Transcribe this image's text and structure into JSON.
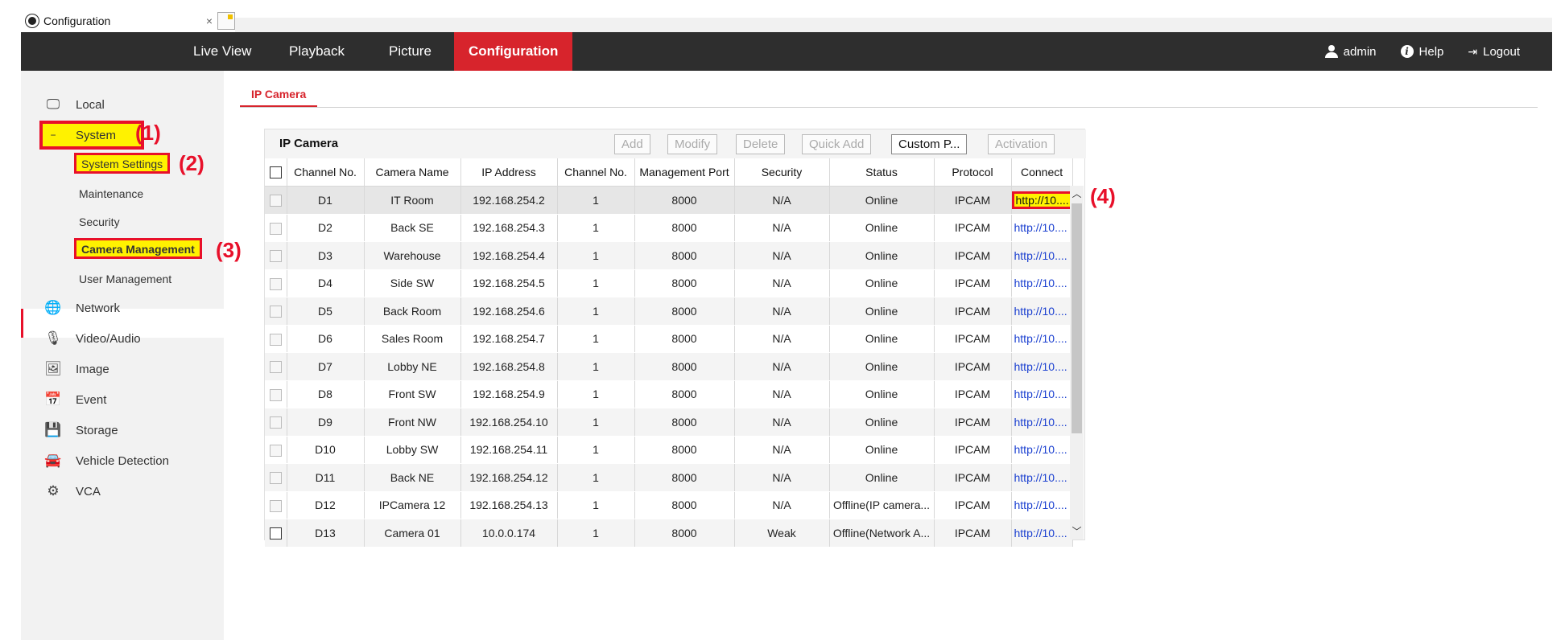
{
  "browser_tab": {
    "title": "Configuration",
    "close": "×"
  },
  "topnav": {
    "items": [
      "Live View",
      "Playback",
      "Picture",
      "Configuration"
    ],
    "user": "admin",
    "help": "Help",
    "logout": "Logout"
  },
  "sidebar": {
    "local": "Local",
    "system": "System",
    "system_sub": [
      "System Settings",
      "Maintenance",
      "Security",
      "Camera Management",
      "User Management"
    ],
    "network": "Network",
    "video_audio": "Video/Audio",
    "image": "Image",
    "event": "Event",
    "storage": "Storage",
    "vehicle_detection": "Vehicle Detection",
    "vca": "VCA"
  },
  "annotations": [
    "(1)",
    "(2)",
    "(3)",
    "(4)"
  ],
  "page_tab": "IP Camera",
  "panel": {
    "title": "IP Camera",
    "buttons": {
      "add": "Add",
      "modify": "Modify",
      "delete": "Delete",
      "quick_add": "Quick Add",
      "custom": "Custom P...",
      "activation": "Activation"
    }
  },
  "table": {
    "headers": [
      "Channel No.",
      "Camera Name",
      "IP Address",
      "Channel No.",
      "Management Port",
      "Security",
      "Status",
      "Protocol",
      "Connect"
    ],
    "rows": [
      [
        "D1",
        "IT Room",
        "192.168.254.2",
        "1",
        "8000",
        "N/A",
        "Online",
        "IPCAM",
        "http://10...."
      ],
      [
        "D2",
        "Back SE",
        "192.168.254.3",
        "1",
        "8000",
        "N/A",
        "Online",
        "IPCAM",
        "http://10...."
      ],
      [
        "D3",
        "Warehouse",
        "192.168.254.4",
        "1",
        "8000",
        "N/A",
        "Online",
        "IPCAM",
        "http://10...."
      ],
      [
        "D4",
        "Side SW",
        "192.168.254.5",
        "1",
        "8000",
        "N/A",
        "Online",
        "IPCAM",
        "http://10...."
      ],
      [
        "D5",
        "Back Room",
        "192.168.254.6",
        "1",
        "8000",
        "N/A",
        "Online",
        "IPCAM",
        "http://10...."
      ],
      [
        "D6",
        "Sales Room",
        "192.168.254.7",
        "1",
        "8000",
        "N/A",
        "Online",
        "IPCAM",
        "http://10...."
      ],
      [
        "D7",
        "Lobby NE",
        "192.168.254.8",
        "1",
        "8000",
        "N/A",
        "Online",
        "IPCAM",
        "http://10...."
      ],
      [
        "D8",
        "Front SW",
        "192.168.254.9",
        "1",
        "8000",
        "N/A",
        "Online",
        "IPCAM",
        "http://10...."
      ],
      [
        "D9",
        "Front NW",
        "192.168.254.10",
        "1",
        "8000",
        "N/A",
        "Online",
        "IPCAM",
        "http://10...."
      ],
      [
        "D10",
        "Lobby SW",
        "192.168.254.11",
        "1",
        "8000",
        "N/A",
        "Online",
        "IPCAM",
        "http://10...."
      ],
      [
        "D11",
        "Back NE",
        "192.168.254.12",
        "1",
        "8000",
        "N/A",
        "Online",
        "IPCAM",
        "http://10...."
      ],
      [
        "D12",
        "IPCamera 12",
        "192.168.254.13",
        "1",
        "8000",
        "N/A",
        "Offline(IP camera...",
        "IPCAM",
        "http://10...."
      ],
      [
        "D13",
        "Camera 01",
        "10.0.0.174",
        "1",
        "8000",
        "Weak",
        "Offline(Network A...",
        "IPCAM",
        "http://10...."
      ]
    ]
  },
  "colors": {
    "accent": "#d7242c",
    "highlight": "#fff200",
    "annotation": "#e8102a",
    "topbar": "#2e2e2e",
    "link": "#1a3fd0"
  }
}
